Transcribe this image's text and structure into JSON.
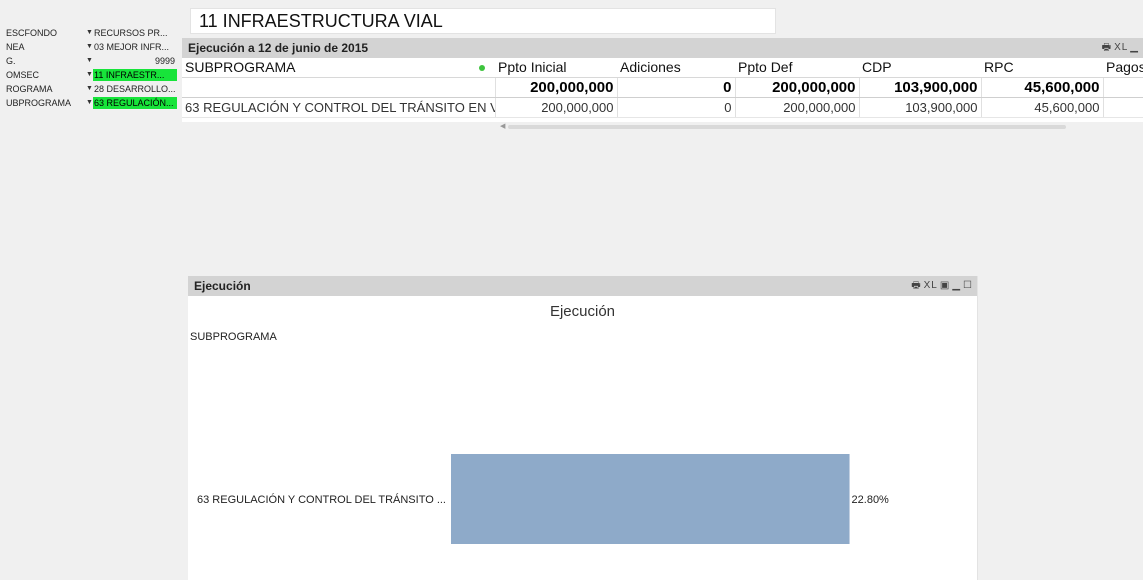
{
  "filters": [
    {
      "label": "ESCFONDO",
      "value": "RECURSOS PR...",
      "selected": false
    },
    {
      "label": "NEA",
      "value": "03 MEJOR INFR...",
      "selected": false
    },
    {
      "label": "G.",
      "value": "9999",
      "selected": false
    },
    {
      "label": "OMSEC",
      "value": "11 INFRAESTR...",
      "selected": true
    },
    {
      "label": "ROGRAMA",
      "value": "28 DESARROLLO...",
      "selected": false
    },
    {
      "label": "UBPROGRAMA",
      "value": "63 REGULACIÓN...",
      "selected": true
    }
  ],
  "title": "11 INFRAESTRUCTURA VIAL",
  "table": {
    "caption": "Ejecución a 12 de junio de 2015",
    "caption_icons": [
      "print-icon",
      "xl-icon",
      "minimize-icon"
    ],
    "columns": [
      "SUBPROGRAMA",
      "Ppto Inicial",
      "Adiciones",
      "Ppto Def",
      "CDP",
      "RPC",
      "Pagos"
    ],
    "totals": [
      "",
      "200,000,000",
      "0",
      "200,000,000",
      "103,900,000",
      "45,600,000",
      ""
    ],
    "rows": [
      [
        "63 REGULACIÓN Y CONTROL DEL TRÁNSITO EN V...",
        "200,000,000",
        "0",
        "200,000,000",
        "103,900,000",
        "45,600,000",
        ""
      ]
    ]
  },
  "chart_panel": {
    "caption": "Ejecución",
    "caption_icons": [
      "print-icon",
      "xl-icon",
      "expand-icon",
      "minimize-icon",
      "maximize-icon"
    ]
  },
  "chart_data": {
    "type": "bar",
    "orientation": "horizontal",
    "title": "Ejecución",
    "dimension_label": "SUBPROGRAMA",
    "categories": [
      "63 REGULACIÓN Y CONTROL DEL TRÁNSITO ..."
    ],
    "values": [
      22.8
    ],
    "value_labels": [
      "22.80%"
    ],
    "bar_color": "#8eaac9"
  }
}
